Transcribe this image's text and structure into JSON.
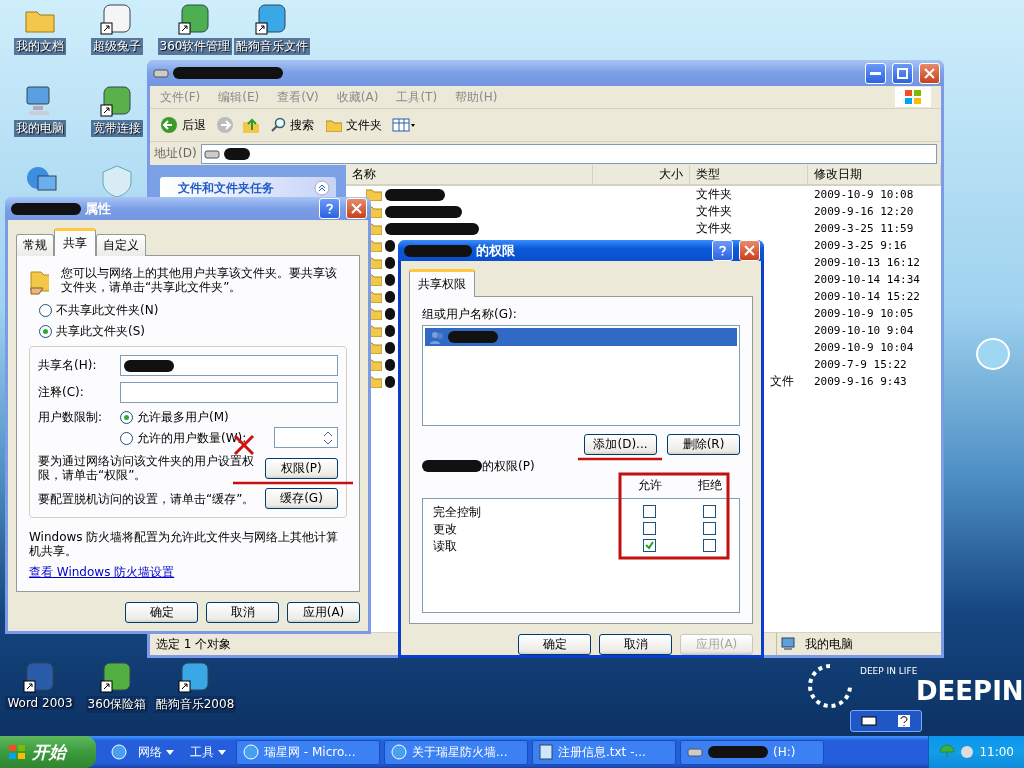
{
  "desktop_icons": [
    {
      "label": "我的文档",
      "kind": "documents",
      "shortcut": false
    },
    {
      "label": "超级兔子",
      "kind": "rabbit",
      "shortcut": true
    },
    {
      "label": "360软件管理",
      "kind": "disc",
      "shortcut": true
    },
    {
      "label": "酷狗音乐文件",
      "kind": "music",
      "shortcut": true
    },
    {
      "label": "我的电脑",
      "kind": "computer",
      "shortcut": false
    },
    {
      "label": "宽带连接",
      "kind": "network",
      "shortcut": true
    },
    {
      "label": "Word 2003",
      "kind": "word",
      "shortcut": true
    },
    {
      "label": "360保险箱",
      "kind": "safe",
      "shortcut": true
    },
    {
      "label": "酷狗音乐2008",
      "kind": "music",
      "shortcut": true
    }
  ],
  "explorer": {
    "menu": [
      "文件(F)",
      "编辑(E)",
      "查看(V)",
      "收藏(A)",
      "工具(T)",
      "帮助(H)"
    ],
    "toolbar": {
      "back": "后退",
      "search": "搜索",
      "folders": "文件夹"
    },
    "address_label": "地址(D)",
    "task_panel_title": "文件和文件夹任务",
    "columns": [
      "名称",
      "大小",
      "类型",
      "修改日期"
    ],
    "rows": [
      {
        "type": "文件夹",
        "modified": "2009-10-9 10:08"
      },
      {
        "type": "文件夹",
        "modified": "2009-9-16 12:20"
      },
      {
        "type": "文件夹",
        "modified": "2009-3-25 11:59"
      },
      {
        "modified": "2009-3-25 9:16"
      },
      {
        "modified": "2009-10-13 16:12"
      },
      {
        "modified": "2009-10-14 14:34"
      },
      {
        "modified": "2009-10-14 15:22"
      },
      {
        "modified": "2009-10-9 10:05"
      },
      {
        "modified": "2009-10-10 9:04"
      },
      {
        "modified": "2009-10-9 10:04"
      },
      {
        "modified": "2009-7-9 15:22"
      },
      {
        "type_tail": "文件",
        "modified": "2009-9-16 9:43"
      }
    ],
    "status": [
      "选定 1 个对象",
      "我的电脑"
    ]
  },
  "properties_dialog": {
    "title": "属性",
    "tabs": [
      {
        "label": "常规",
        "selected": false
      },
      {
        "label": "共享",
        "selected": true
      },
      {
        "label": "自定义",
        "selected": false
      }
    ],
    "intro": "您可以与网络上的其他用户共享该文件夹。要共享该文件夹，请单击“共享此文件夹”。",
    "share_options": [
      {
        "label": "不共享此文件夹(N)",
        "selected": false
      },
      {
        "label": "共享此文件夹(S)",
        "selected": true
      }
    ],
    "share_name_label": "共享名(H):",
    "comment_label": "注释(C):",
    "user_limit_label": "用户数限制:",
    "limit_options": [
      {
        "label": "允许最多用户(M)",
        "selected": true
      },
      {
        "label": "允许的用户数量(W):",
        "selected": false
      }
    ],
    "permissions_text": "要为通过网络访问该文件夹的用户设置权限，请单击“权限”。",
    "permissions_button": "权限(P)",
    "cache_text": "要配置脱机访问的设置，请单击“缓存”。",
    "cache_button": "缓存(G)",
    "firewall_text": "Windows 防火墙将配置为允许此文件夹与网络上其他计算机共享。",
    "firewall_link": "查看 Windows 防火墙设置",
    "buttons": [
      {
        "label": "确定",
        "disabled": false
      },
      {
        "label": "取消",
        "disabled": false
      },
      {
        "label": "应用(A)",
        "disabled": false
      }
    ]
  },
  "permissions_dialog": {
    "title": "的权限",
    "tabs": [
      {
        "label": "共享权限",
        "selected": true
      }
    ],
    "users_label": "组或用户名称(G):",
    "add_button": "添加(D)...",
    "remove_button": "删除(R)",
    "permissions_label": "的权限(P)",
    "allow_header": "允许",
    "deny_header": "拒绝",
    "permissions": [
      {
        "name": "完全控制",
        "allow": false,
        "deny": false
      },
      {
        "name": "更改",
        "allow": false,
        "deny": false
      },
      {
        "name": "读取",
        "allow": true,
        "deny": false
      }
    ],
    "buttons": [
      {
        "label": "确定",
        "disabled": false
      },
      {
        "label": "取消",
        "disabled": false
      },
      {
        "label": "应用(A)",
        "disabled": true
      }
    ]
  },
  "logo": {
    "tagline": "DEEP IN LIFE",
    "name": "DEEPIN"
  },
  "taskbar": {
    "start": "开始",
    "quick": [
      "网络",
      "工具"
    ],
    "tasks": [
      {
        "label": "瑞星网 - Micro...",
        "kind": "ie"
      },
      {
        "label": "关于瑞星防火墙...",
        "kind": "ie"
      },
      {
        "label": "注册信息.txt -...",
        "kind": "notepad"
      },
      {
        "label": "(H:)",
        "kind": "drive"
      }
    ],
    "clock": "11:00"
  }
}
